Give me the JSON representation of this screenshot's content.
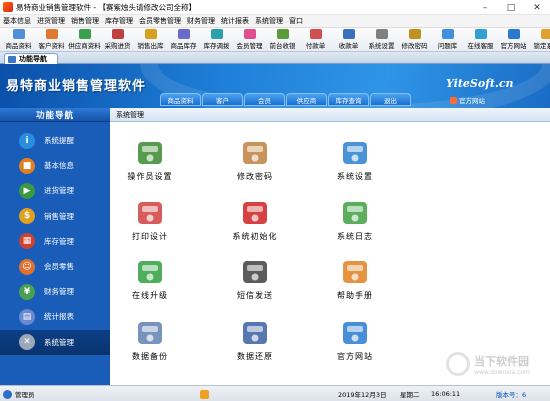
{
  "window": {
    "title": "易特商业销售管理软件 - 【赛紫烛头请修改公司全称】",
    "controls": [
      "minimize",
      "maximize",
      "close"
    ]
  },
  "menu": [
    "基本信息",
    "进货管理",
    "销售管理",
    "库存管理",
    "会员零售管理",
    "财务管理",
    "统计报表",
    "系统管理",
    "窗口"
  ],
  "toolbar": [
    {
      "label": "商品资料",
      "icon": "box-icon",
      "color": "#4f8fd8"
    },
    {
      "label": "客户资料",
      "icon": "customer-icon",
      "color": "#e07830"
    },
    {
      "label": "供应商资料",
      "icon": "supplier-icon",
      "color": "#3aa050"
    },
    {
      "label": "采购进货",
      "icon": "purchase-icon",
      "color": "#c04040"
    },
    {
      "label": "销售出库",
      "icon": "sales-icon",
      "color": "#d8a020"
    },
    {
      "label": "商品库存",
      "icon": "stock-icon",
      "color": "#6a6acb"
    },
    {
      "label": "库存调拨",
      "icon": "transfer-icon",
      "color": "#2aa0b0"
    },
    {
      "label": "会员管理",
      "icon": "member-icon",
      "color": "#e05090"
    },
    {
      "label": "前台收银",
      "icon": "cashier-icon",
      "color": "#5a9a3a"
    },
    {
      "label": "付款单",
      "icon": "payment-icon",
      "color": "#d05050"
    },
    {
      "label": "收款单",
      "icon": "receipt-icon",
      "color": "#3a70c0"
    },
    {
      "label": "系统设置",
      "icon": "settings-icon",
      "color": "#808080"
    },
    {
      "label": "修改密码",
      "icon": "key-icon",
      "color": "#c09020"
    },
    {
      "label": "问题库",
      "icon": "question-icon",
      "color": "#4090e0"
    },
    {
      "label": "在线客服",
      "icon": "chat-icon",
      "color": "#30a0d0"
    },
    {
      "label": "官方网站",
      "icon": "globe-icon",
      "color": "#2a7ad0"
    },
    {
      "label": "锁定系统",
      "icon": "lock-icon",
      "color": "#e0a030"
    }
  ],
  "doc_tab": "功能导航",
  "banner": {
    "app_title": "易特商业销售管理软件",
    "brand": "YiteSoft.cn",
    "site_link": "官方网站",
    "tabs": [
      "商品资料",
      "客户",
      "会员",
      "供应商",
      "库存查询",
      "退出"
    ]
  },
  "sidebar": {
    "title": "功能导航",
    "items": [
      {
        "label": "系统提醒",
        "icon": "info-icon",
        "color": "#2a8ee0",
        "glyph": "i"
      },
      {
        "label": "基本信息",
        "icon": "boxes-icon",
        "color": "#e08020",
        "glyph": "■"
      },
      {
        "label": "进货管理",
        "icon": "truck-icon",
        "color": "#3a9a40",
        "glyph": "▶"
      },
      {
        "label": "销售管理",
        "icon": "sales-icon",
        "color": "#e0a020",
        "glyph": "$"
      },
      {
        "label": "库存管理",
        "icon": "warehouse-icon",
        "color": "#d04030",
        "glyph": "▦"
      },
      {
        "label": "会员零售",
        "icon": "member-icon",
        "color": "#e07030",
        "glyph": "☺"
      },
      {
        "label": "财务管理",
        "icon": "finance-icon",
        "color": "#4aa050",
        "glyph": "¥"
      },
      {
        "label": "统计报表",
        "icon": "report-icon",
        "color": "#6a8ad0",
        "glyph": "▤"
      },
      {
        "label": "系统管理",
        "icon": "tools-icon",
        "color": "#9aa8b8",
        "glyph": "✕"
      }
    ],
    "active_index": 8
  },
  "content": {
    "section_title": "系统管理",
    "items": [
      {
        "label": "操作员设置",
        "icon": "operator-icon",
        "color": "#3a8a30"
      },
      {
        "label": "修改密码",
        "icon": "password-icon",
        "color": "#c08040"
      },
      {
        "label": "系统设置",
        "icon": "settings-globe-icon",
        "color": "#2a80d0"
      },
      {
        "label": "打印设计",
        "icon": "printer-icon",
        "color": "#d04040"
      },
      {
        "label": "系统初始化",
        "icon": "reset-icon",
        "color": "#d02020"
      },
      {
        "label": "系统日志",
        "icon": "log-icon",
        "color": "#40a040"
      },
      {
        "label": "在线升级",
        "icon": "upgrade-icon",
        "color": "#30a040"
      },
      {
        "label": "短信发送",
        "icon": "sms-icon",
        "color": "#404040"
      },
      {
        "label": "帮助手册",
        "icon": "help-icon",
        "color": "#e08020"
      },
      {
        "label": "数据备份",
        "icon": "backup-icon",
        "color": "#6080b0"
      },
      {
        "label": "数据还原",
        "icon": "restore-icon",
        "color": "#3a60a0"
      },
      {
        "label": "官方网站",
        "icon": "ie-icon",
        "color": "#2a7ad0"
      }
    ]
  },
  "status": {
    "user": "管理员",
    "date": "2019年12月3日",
    "weekday": "星期二",
    "time": "16:06:11",
    "version": "版本号：6"
  },
  "watermark": {
    "title": "当下软件园",
    "subtitle": "www.downxia.com"
  }
}
